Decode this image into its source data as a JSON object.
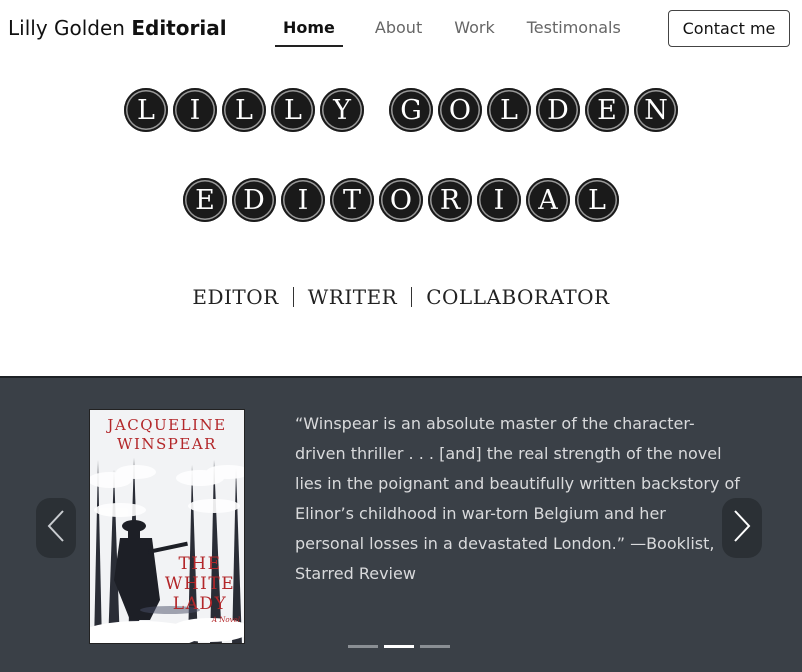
{
  "header": {
    "brand_regular": "Lilly Golden ",
    "brand_bold": "Editorial",
    "nav": [
      {
        "label": "Home",
        "active": true
      },
      {
        "label": "About",
        "active": false
      },
      {
        "label": "Work",
        "active": false
      },
      {
        "label": "Testimonals",
        "active": false
      }
    ],
    "contact_label": "Contact me"
  },
  "hero": {
    "line1_words": [
      "LILLY",
      "GOLDEN"
    ],
    "line2_words": [
      "EDITORIAL"
    ],
    "roles": [
      "EDITOR",
      "WRITER",
      "COLLABORATOR"
    ]
  },
  "testimonial": {
    "cover": {
      "author_line1": "JACQUELINE",
      "author_line2": "WINSPEAR",
      "title_line1": "THE",
      "title_line2": "WHITE",
      "title_line3": "LADY",
      "subtitle": "A Novel"
    },
    "quote": "“Winspear is an absolute master of the character-driven thriller . . . [and] the real strength of the novel lies in the poignant and beautifully written backstory of Elinor’s childhood in war-torn Belgium and her personal losses in a devastated London.” —Booklist, Starred Review",
    "slide_count": 3,
    "active_slide": 2,
    "prev_icon": "chevron-left-icon",
    "next_icon": "chevron-right-icon"
  },
  "colors": {
    "band_bg": "#3a4047",
    "key_bg": "#1a1a1a",
    "cover_accent": "#b3272a"
  }
}
